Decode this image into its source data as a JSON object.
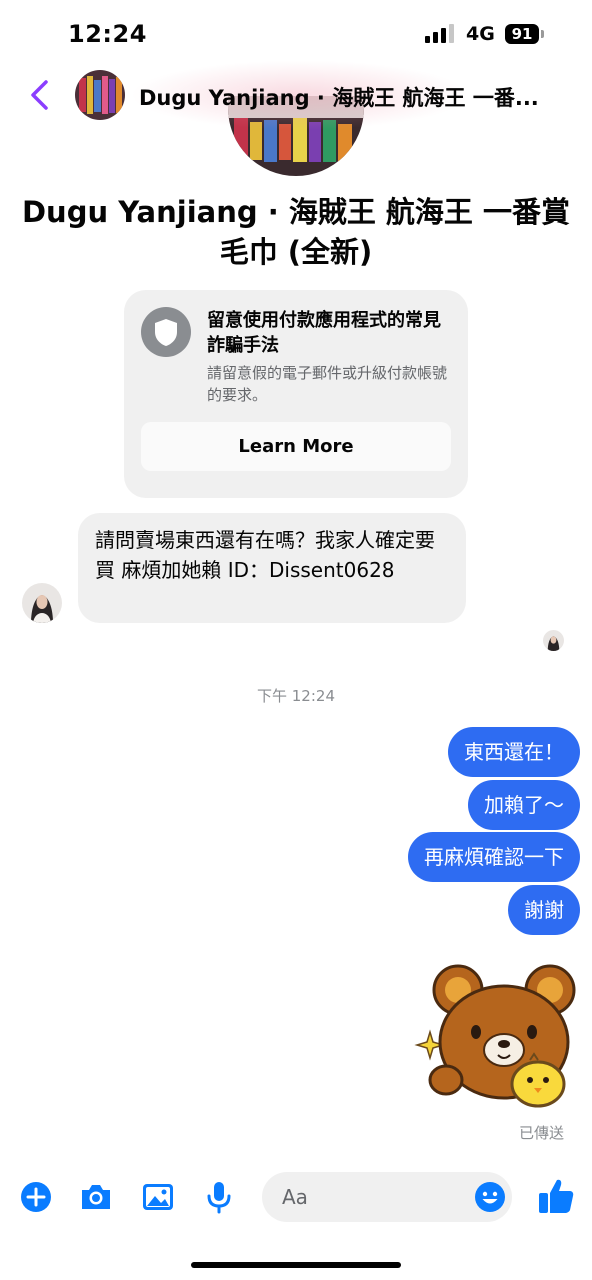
{
  "status_bar": {
    "time": "12:24",
    "network": "4G",
    "battery": "91"
  },
  "header": {
    "title": "Dugu Yanjiang · 海賊王 航海王 一番..."
  },
  "profile": {
    "name": "Dugu Yanjiang · 海賊王 航海王 一番賞毛巾 (全新)"
  },
  "safety_notice": {
    "title": "留意使用付款應用程式的常見詐騙手法",
    "body": "請留意假的電子郵件或升級付款帳號的要求。",
    "button_label": "Learn More"
  },
  "messages": {
    "incoming": [
      {
        "text": "請問賣場東西還有在嗎？我家人確定要買 麻煩加她賴 ID：Dissent0628"
      }
    ],
    "timestamp": "下午 12:24",
    "outgoing": [
      {
        "text": "東西還在！"
      },
      {
        "text": "加賴了～"
      },
      {
        "text": "再麻煩確認一下"
      },
      {
        "text": "謝謝"
      }
    ],
    "sent_status": "已傳送"
  },
  "composer": {
    "placeholder": "Aa"
  },
  "icons": {
    "back": "chevron-left-icon",
    "shield": "shield-icon",
    "add": "plus-circle-icon",
    "camera": "camera-icon",
    "gallery": "image-icon",
    "mic": "microphone-icon",
    "emoji": "smiley-icon",
    "like": "thumbs-up-icon",
    "sticker": "bear-sticker"
  },
  "colors": {
    "accent": "#0a7cff",
    "back_arrow": "#8b3dff",
    "outgoing_bubble": "#2e6cf2",
    "incoming_bubble": "#f0f0f0",
    "muted_text": "#8a8d91"
  }
}
